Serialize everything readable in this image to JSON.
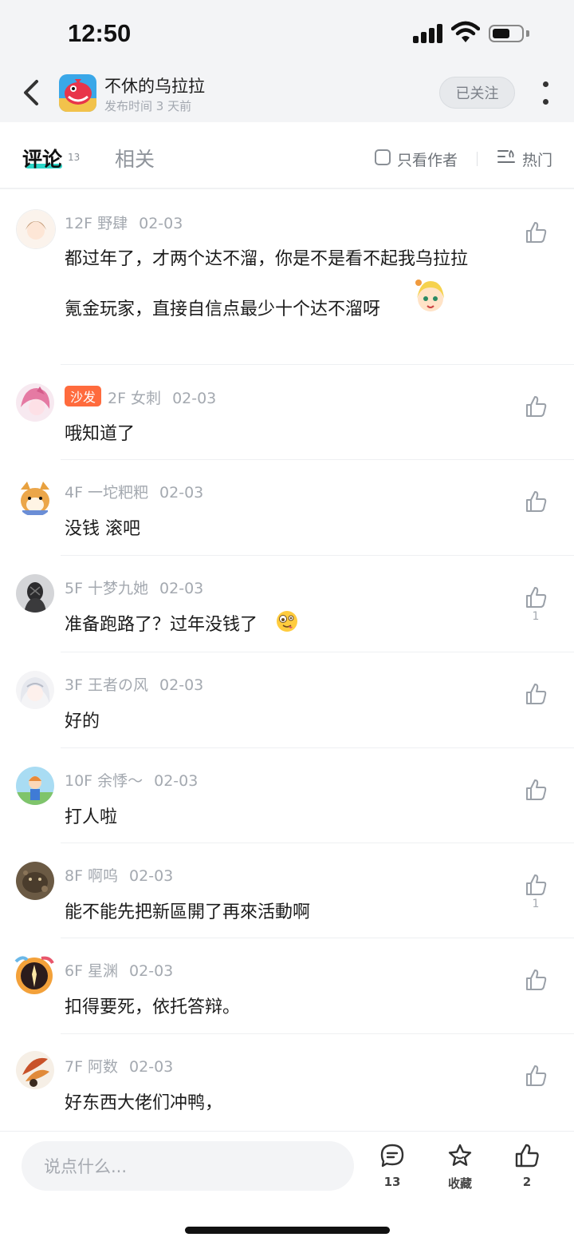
{
  "status_bar": {
    "time": "12:50"
  },
  "header": {
    "title": "不休的乌拉拉",
    "subtitle": "发布时间 3 天前",
    "follow_label": "已关注"
  },
  "tabs": {
    "comment_label": "评论",
    "comment_count": "13",
    "related_label": "相关",
    "author_only_label": "只看作者",
    "sort_label": "热门"
  },
  "comments": [
    {
      "floor": "12F",
      "name": "野肆",
      "date": "02-03",
      "lines": [
        "都过年了，才两个达不溜，你是不是看不起我乌拉拉",
        "氪金玩家，直接自信点最少十个达不溜呀"
      ],
      "sticker": "anime-girl-sticker"
    },
    {
      "badge": "沙发",
      "floor": "2F",
      "name": "女刺",
      "date": "02-03",
      "lines": [
        "哦知道了"
      ]
    },
    {
      "floor": "4F",
      "name": "一坨粑粑",
      "date": "02-03",
      "lines": [
        "没钱 滚吧"
      ]
    },
    {
      "floor": "5F",
      "name": "十梦九她",
      "date": "02-03",
      "lines": [
        "准备跑路了？过年没钱了"
      ],
      "likes": "1",
      "emoji": "crazy-face-emoji"
    },
    {
      "floor": "3F",
      "name": "王者の风",
      "date": "02-03",
      "lines": [
        "好的"
      ]
    },
    {
      "floor": "10F",
      "name": "余悸～",
      "date": "02-03",
      "lines": [
        "打人啦"
      ]
    },
    {
      "floor": "8F",
      "name": "啊呜",
      "date": "02-03",
      "lines": [
        "能不能先把新區開了再來活動啊"
      ],
      "likes": "1"
    },
    {
      "floor": "6F",
      "name": "星渊",
      "date": "02-03",
      "lines": [
        "扣得要死，依托答辩。"
      ]
    },
    {
      "floor": "7F",
      "name": "阿数",
      "date": "02-03",
      "lines": [
        "好东西大佬们冲鸭，"
      ]
    }
  ],
  "bottom_bar": {
    "input_placeholder": "说点什么...",
    "comment_count": "13",
    "favorite_label": "收藏",
    "like_count": "2"
  }
}
